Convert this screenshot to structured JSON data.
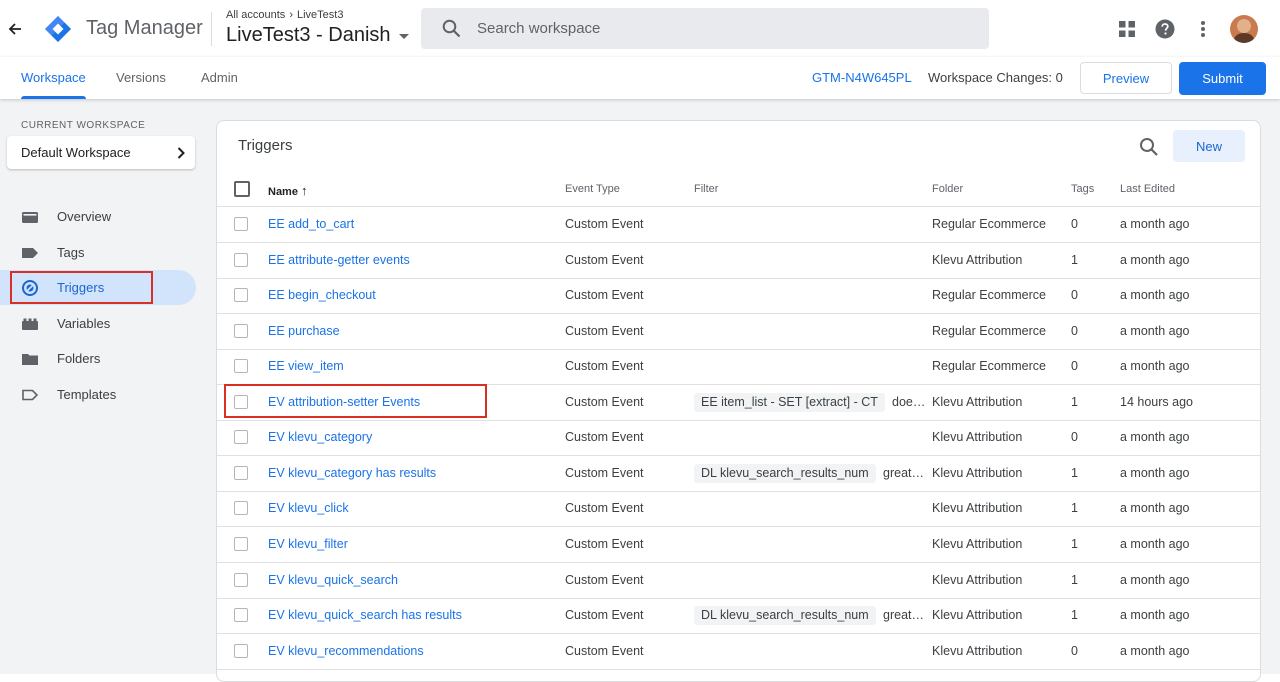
{
  "header": {
    "product_name": "Tag Manager",
    "breadcrumb": [
      "All accounts",
      "LiveTest3"
    ],
    "breadcrumb_sep": "›",
    "container_name": "LiveTest3 - Danish",
    "search_placeholder": "Search workspace"
  },
  "tabs": {
    "items": [
      "Workspace",
      "Versions",
      "Admin"
    ],
    "active": "Workspace",
    "container_id": "GTM-N4W645PL",
    "workspace_changes": "Workspace Changes: 0",
    "preview_label": "Preview",
    "submit_label": "Submit"
  },
  "sidebar": {
    "current_workspace_label": "CURRENT WORKSPACE",
    "workspace_name": "Default Workspace",
    "items": [
      {
        "label": "Overview",
        "icon": "folder-open-icon"
      },
      {
        "label": "Tags",
        "icon": "tag-icon"
      },
      {
        "label": "Triggers",
        "icon": "trigger-icon"
      },
      {
        "label": "Variables",
        "icon": "variables-icon"
      },
      {
        "label": "Folders",
        "icon": "folder-icon"
      },
      {
        "label": "Templates",
        "icon": "template-icon"
      }
    ],
    "active": "Triggers"
  },
  "triggers": {
    "title": "Triggers",
    "new_label": "New",
    "columns": [
      "Name",
      "Event Type",
      "Filter",
      "Folder",
      "Tags",
      "Last Edited"
    ],
    "sort_indicator": "↑",
    "rows": [
      {
        "name": "EE add_to_cart",
        "event_type": "Custom Event",
        "filter_var": "",
        "filter_op": "",
        "folder": "Regular Ecommerce",
        "tags": "0",
        "last_edited": "a month ago"
      },
      {
        "name": "EE attribute-getter events",
        "event_type": "Custom Event",
        "filter_var": "",
        "filter_op": "",
        "folder": "Klevu Attribution",
        "tags": "1",
        "last_edited": "a month ago"
      },
      {
        "name": "EE begin_checkout",
        "event_type": "Custom Event",
        "filter_var": "",
        "filter_op": "",
        "folder": "Regular Ecommerce",
        "tags": "0",
        "last_edited": "a month ago"
      },
      {
        "name": "EE purchase",
        "event_type": "Custom Event",
        "filter_var": "",
        "filter_op": "",
        "folder": "Regular Ecommerce",
        "tags": "0",
        "last_edited": "a month ago"
      },
      {
        "name": "EE view_item",
        "event_type": "Custom Event",
        "filter_var": "",
        "filter_op": "",
        "folder": "Regular Ecommerce",
        "tags": "0",
        "last_edited": "a month ago"
      },
      {
        "name": "EV attribution-setter Events",
        "event_type": "Custom Event",
        "filter_var": "EE item_list - SET [extract] - CT",
        "filter_op": "does …",
        "folder": "Klevu Attribution",
        "tags": "1",
        "last_edited": "14 hours ago"
      },
      {
        "name": "EV klevu_category",
        "event_type": "Custom Event",
        "filter_var": "",
        "filter_op": "",
        "folder": "Klevu Attribution",
        "tags": "0",
        "last_edited": "a month ago"
      },
      {
        "name": "EV klevu_category has results",
        "event_type": "Custom Event",
        "filter_var": "DL klevu_search_results_num",
        "filter_op": "greate…",
        "folder": "Klevu Attribution",
        "tags": "1",
        "last_edited": "a month ago"
      },
      {
        "name": "EV klevu_click",
        "event_type": "Custom Event",
        "filter_var": "",
        "filter_op": "",
        "folder": "Klevu Attribution",
        "tags": "1",
        "last_edited": "a month ago"
      },
      {
        "name": "EV klevu_filter",
        "event_type": "Custom Event",
        "filter_var": "",
        "filter_op": "",
        "folder": "Klevu Attribution",
        "tags": "1",
        "last_edited": "a month ago"
      },
      {
        "name": "EV klevu_quick_search",
        "event_type": "Custom Event",
        "filter_var": "",
        "filter_op": "",
        "folder": "Klevu Attribution",
        "tags": "1",
        "last_edited": "a month ago"
      },
      {
        "name": "EV klevu_quick_search has results",
        "event_type": "Custom Event",
        "filter_var": "DL klevu_search_results_num",
        "filter_op": "greate…",
        "folder": "Klevu Attribution",
        "tags": "1",
        "last_edited": "a month ago"
      },
      {
        "name": "EV klevu_recommendations",
        "event_type": "Custom Event",
        "filter_var": "",
        "filter_op": "",
        "folder": "Klevu Attribution",
        "tags": "0",
        "last_edited": "a month ago"
      }
    ]
  },
  "colors": {
    "accent": "#1a73e8",
    "highlight_outline": "#d93025",
    "nav_active_bg": "#d2e3fc"
  }
}
